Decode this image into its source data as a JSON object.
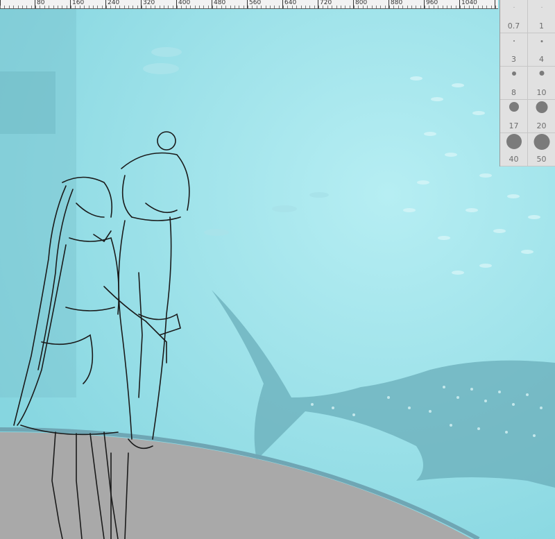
{
  "ruler": {
    "labels": [
      "80",
      "160",
      "240",
      "320",
      "400",
      "480",
      "560",
      "640",
      "720",
      "800",
      "880",
      "960",
      "1040"
    ]
  },
  "brush_palette": {
    "sizes": [
      "0.7",
      "1",
      "3",
      "4",
      "8",
      "10",
      "17",
      "20",
      "40",
      "50"
    ]
  },
  "colors": {
    "water": "#8fdde6",
    "floor": "#a9a9a9",
    "rail": "#6fa6b4",
    "sketch_line": "#1a1a1a",
    "ruler_bg": "#f2f2f2",
    "palette_bg": "#e1e1e1"
  }
}
